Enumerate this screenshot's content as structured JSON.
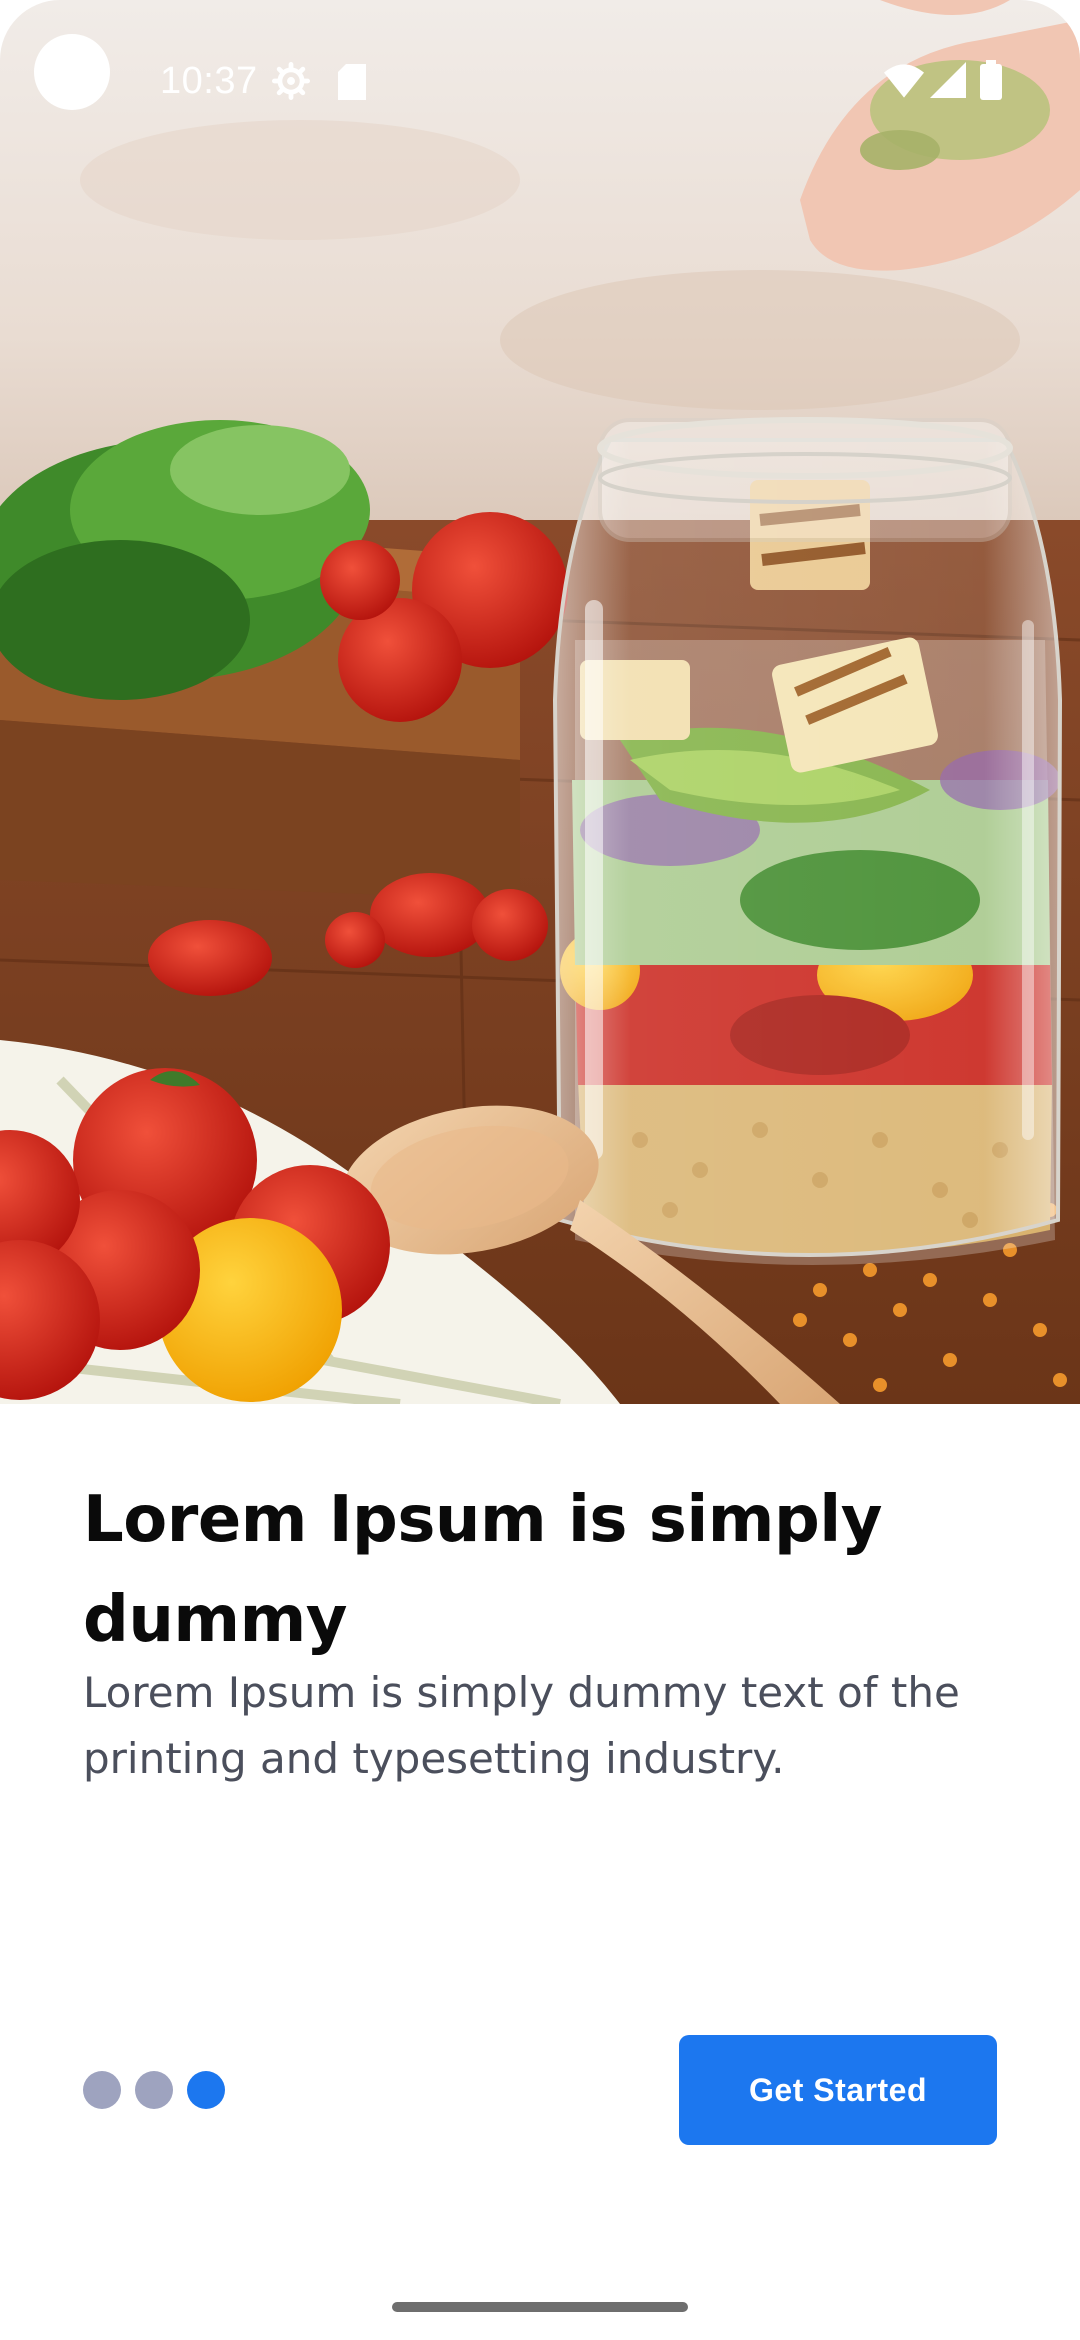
{
  "status_bar": {
    "time": "10:37",
    "icons": [
      "settings-gear-icon",
      "sd-card-icon",
      "wifi-icon",
      "cellular-signal-icon",
      "battery-icon"
    ]
  },
  "hero": {
    "icon": "salad-jar-photo"
  },
  "onboarding": {
    "title": "Lorem Ipsum is simply dummy",
    "subtitle": "Lorem Ipsum is simply dummy text of the printing and typesetting industry.",
    "page_indicator": {
      "total": 3,
      "current": 3
    },
    "cta_label": "Get Started"
  },
  "colors": {
    "accent": "#1c77ef",
    "dot_inactive": "#9ea3bf",
    "title_text": "#0a0a0a",
    "body_text": "#4b4f5c"
  }
}
